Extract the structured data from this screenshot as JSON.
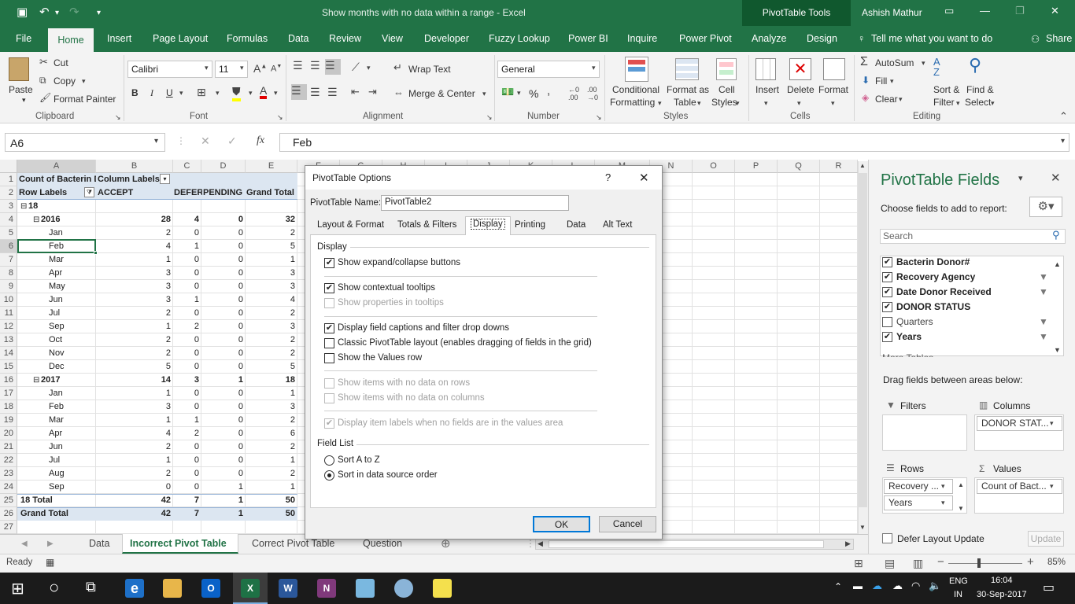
{
  "titlebar": {
    "title": "Show months with no data within a range  -  Excel",
    "context_tab": "PivotTable Tools",
    "user": "Ashish Mathur"
  },
  "ribbon_tabs": [
    "File",
    "Home",
    "Insert",
    "Page Layout",
    "Formulas",
    "Data",
    "Review",
    "View",
    "Developer",
    "Fuzzy Lookup",
    "Power BI",
    "Inquire",
    "Power Pivot",
    "Analyze",
    "Design"
  ],
  "tell_me": "Tell me what you want to do",
  "share": "Share",
  "ribbon": {
    "paste": "Paste",
    "cut": "Cut",
    "copy": "Copy",
    "format_painter": "Format Painter",
    "clipboard": "Clipboard",
    "font_name": "Calibri",
    "font_size": "11",
    "font": "Font",
    "bold": "B",
    "italic": "I",
    "underline": "U",
    "wrap_text": "Wrap Text",
    "merge_center": "Merge & Center",
    "alignment": "Alignment",
    "number_format": "General",
    "number": "Number",
    "percent": "%",
    "conditional": "Conditional",
    "conditional2": "Formatting",
    "format_as": "Format as",
    "format_as2": "Table",
    "cell": "Cell",
    "cell2": "Styles",
    "styles": "Styles",
    "insert": "Insert",
    "delete": "Delete",
    "format": "Format",
    "cells": "Cells",
    "autosum": "AutoSum",
    "fill": "Fill",
    "clear": "Clear",
    "sort": "Sort &",
    "sort2": "Filter",
    "find": "Find &",
    "find2": "Select",
    "editing": "Editing"
  },
  "formula_bar": {
    "name_box": "A6",
    "value": "Feb"
  },
  "grid": {
    "col_headers": [
      "A",
      "B",
      "C",
      "D",
      "E",
      "F",
      "G",
      "H",
      "I",
      "J",
      "K",
      "L",
      "M",
      "N",
      "O",
      "P",
      "Q",
      "R"
    ],
    "row1": {
      "a": "Count of Bacterin D",
      "b": "Column Labels"
    },
    "row2": {
      "a": "Row Labels",
      "b": "ACCEPT",
      "c": "DEFER",
      "d": "PENDING",
      "e": "Grand Total"
    },
    "rows": [
      {
        "n": "3",
        "a": "18",
        "lvl": 0,
        "b": "",
        "c": "",
        "d": "",
        "e": "",
        "bold": true,
        "toggle": "⊟"
      },
      {
        "n": "4",
        "a": "2016",
        "lvl": 1,
        "b": "28",
        "c": "4",
        "d": "0",
        "e": "32",
        "bold": true,
        "toggle": "⊟"
      },
      {
        "n": "5",
        "a": "Jan",
        "lvl": 2,
        "b": "2",
        "c": "0",
        "d": "0",
        "e": "2"
      },
      {
        "n": "6",
        "a": "Feb",
        "lvl": 2,
        "b": "4",
        "c": "1",
        "d": "0",
        "e": "5"
      },
      {
        "n": "7",
        "a": "Mar",
        "lvl": 2,
        "b": "1",
        "c": "0",
        "d": "0",
        "e": "1"
      },
      {
        "n": "8",
        "a": "Apr",
        "lvl": 2,
        "b": "3",
        "c": "0",
        "d": "0",
        "e": "3"
      },
      {
        "n": "9",
        "a": "May",
        "lvl": 2,
        "b": "3",
        "c": "0",
        "d": "0",
        "e": "3"
      },
      {
        "n": "10",
        "a": "Jun",
        "lvl": 2,
        "b": "3",
        "c": "1",
        "d": "0",
        "e": "4"
      },
      {
        "n": "11",
        "a": "Jul",
        "lvl": 2,
        "b": "2",
        "c": "0",
        "d": "0",
        "e": "2"
      },
      {
        "n": "12",
        "a": "Sep",
        "lvl": 2,
        "b": "1",
        "c": "2",
        "d": "0",
        "e": "3"
      },
      {
        "n": "13",
        "a": "Oct",
        "lvl": 2,
        "b": "2",
        "c": "0",
        "d": "0",
        "e": "2"
      },
      {
        "n": "14",
        "a": "Nov",
        "lvl": 2,
        "b": "2",
        "c": "0",
        "d": "0",
        "e": "2"
      },
      {
        "n": "15",
        "a": "Dec",
        "lvl": 2,
        "b": "5",
        "c": "0",
        "d": "0",
        "e": "5"
      },
      {
        "n": "16",
        "a": "2017",
        "lvl": 1,
        "b": "14",
        "c": "3",
        "d": "1",
        "e": "18",
        "bold": true,
        "toggle": "⊟"
      },
      {
        "n": "17",
        "a": "Jan",
        "lvl": 2,
        "b": "1",
        "c": "0",
        "d": "0",
        "e": "1"
      },
      {
        "n": "18",
        "a": "Feb",
        "lvl": 2,
        "b": "3",
        "c": "0",
        "d": "0",
        "e": "3"
      },
      {
        "n": "19",
        "a": "Mar",
        "lvl": 2,
        "b": "1",
        "c": "1",
        "d": "0",
        "e": "2"
      },
      {
        "n": "20",
        "a": "Apr",
        "lvl": 2,
        "b": "4",
        "c": "2",
        "d": "0",
        "e": "6"
      },
      {
        "n": "21",
        "a": "Jun",
        "lvl": 2,
        "b": "2",
        "c": "0",
        "d": "0",
        "e": "2"
      },
      {
        "n": "22",
        "a": "Jul",
        "lvl": 2,
        "b": "1",
        "c": "0",
        "d": "0",
        "e": "1"
      },
      {
        "n": "23",
        "a": "Aug",
        "lvl": 2,
        "b": "2",
        "c": "0",
        "d": "0",
        "e": "2"
      },
      {
        "n": "24",
        "a": "Sep",
        "lvl": 2,
        "b": "0",
        "c": "0",
        "d": "1",
        "e": "1"
      },
      {
        "n": "25",
        "a": "18 Total",
        "lvl": 0,
        "b": "42",
        "c": "7",
        "d": "1",
        "e": "50",
        "bold": true
      },
      {
        "n": "26",
        "a": "Grand Total",
        "lvl": 0,
        "b": "42",
        "c": "7",
        "d": "1",
        "e": "50",
        "bold": true,
        "shade": true
      },
      {
        "n": "27",
        "a": "",
        "lvl": 0,
        "b": "",
        "c": "",
        "d": "",
        "e": ""
      }
    ],
    "row_headers_top": [
      "1",
      "2"
    ]
  },
  "sheet_tabs": [
    "Data",
    "Incorrect Pivot Table",
    "Correct Pivot Table",
    "Question"
  ],
  "active_sheet": "Incorrect Pivot Table",
  "status": {
    "ready": "Ready",
    "zoom": "85%"
  },
  "dialog": {
    "title": "PivotTable Options",
    "help": "?",
    "close": "✕",
    "name_label": "PivotTable Name:",
    "name_value": "PivotTable2",
    "tabs": [
      "Layout & Format",
      "Totals & Filters",
      "Display",
      "Printing",
      "Data",
      "Alt Text"
    ],
    "active_tab": "Display",
    "section_display": "Display",
    "opt_expand": "Show expand/collapse buttons",
    "opt_tooltips": "Show contextual tooltips",
    "opt_properties": "Show properties in tooltips",
    "opt_captions": "Display field captions and filter drop downs",
    "opt_classic": "Classic PivotTable layout (enables dragging of fields in the grid)",
    "opt_values_row": "Show the Values row",
    "opt_nodata_rows": "Show items with no data on rows",
    "opt_nodata_cols": "Show items with no data on columns",
    "opt_item_labels": "Display item labels when no fields are in the values area",
    "section_fieldlist": "Field List",
    "sort_az": "Sort A to Z",
    "sort_source": "Sort in data source order",
    "ok": "OK",
    "cancel": "Cancel"
  },
  "pane": {
    "title": "PivotTable Fields",
    "subtitle": "Choose fields to add to report:",
    "search_placeholder": "Search",
    "fields": [
      {
        "name": "Bacterin Donor#",
        "checked": true,
        "bold": true,
        "filter": false
      },
      {
        "name": "Recovery Agency",
        "checked": true,
        "bold": true,
        "filter": true
      },
      {
        "name": "Date Donor Received",
        "checked": true,
        "bold": true,
        "filter": true
      },
      {
        "name": "DONOR STATUS",
        "checked": true,
        "bold": true,
        "filter": false
      },
      {
        "name": "Quarters",
        "checked": false,
        "bold": false,
        "filter": true
      },
      {
        "name": "Years",
        "checked": true,
        "bold": true,
        "filter": true
      }
    ],
    "more_tables": "More Tables...",
    "drag_text": "Drag fields between areas below:",
    "filters": "Filters",
    "columns": "Columns",
    "rows": "Rows",
    "values": "Values",
    "columns_item": "DONOR STAT...",
    "rows_items": [
      "Recovery ...",
      "Years"
    ],
    "values_item": "Count of Bact...",
    "defer": "Defer Layout Update",
    "update": "Update"
  },
  "taskbar": {
    "lang": "ENG",
    "region": "IN",
    "time": "16:04",
    "date": "30-Sep-2017"
  }
}
